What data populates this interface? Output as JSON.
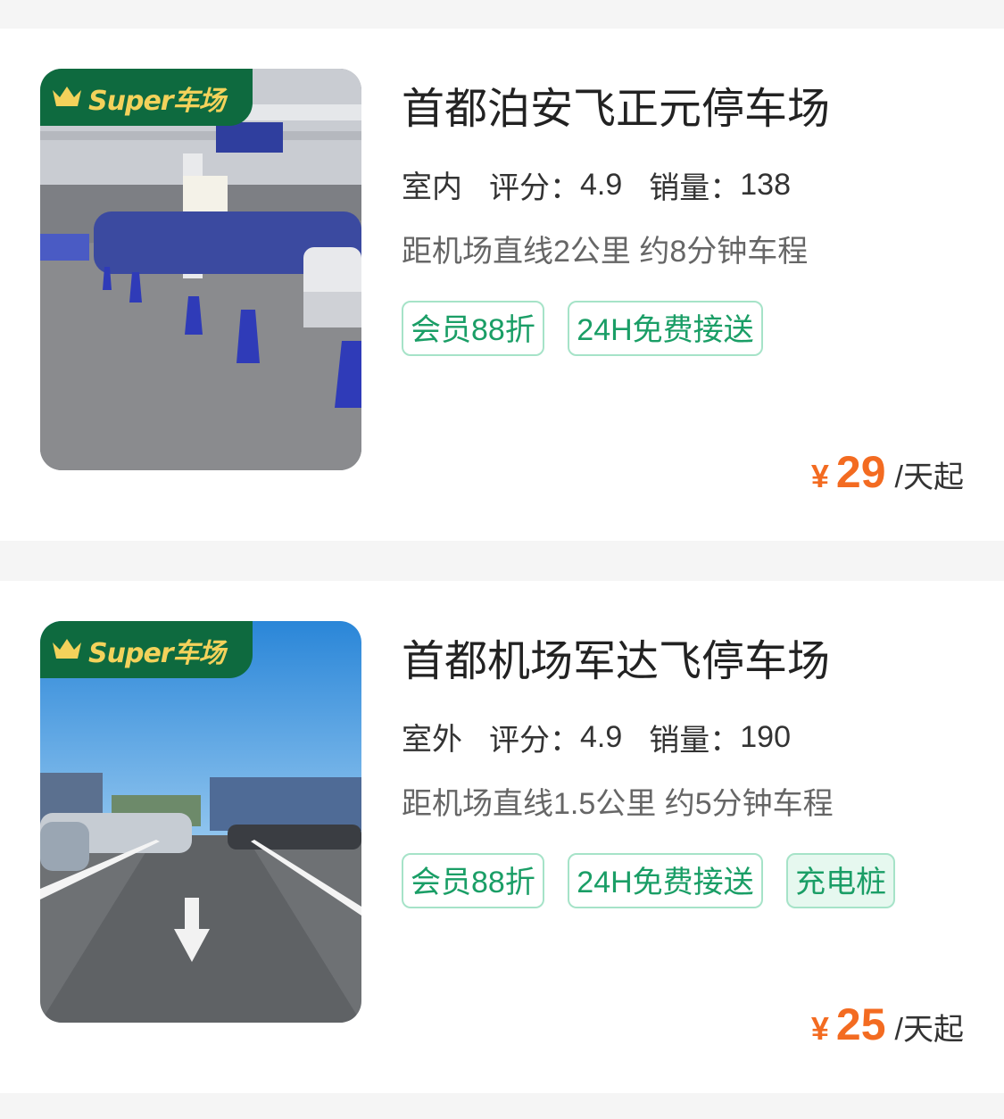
{
  "listings": [
    {
      "badge": "Super车场",
      "name": "首都泊安飞正元停车场",
      "environment": "室内",
      "rating_label": "评分：",
      "rating": "4.9",
      "sales_label": "销量：",
      "sales": "138",
      "distance": "距机场直线2公里 约8分钟车程",
      "tags": [
        "会员88折",
        "24H免费接送"
      ],
      "price_currency": "¥",
      "price": "29",
      "price_unit": "/天起"
    },
    {
      "badge": "Super车场",
      "name": "首都机场军达飞停车场",
      "environment": "室外",
      "rating_label": "评分：",
      "rating": "4.9",
      "sales_label": "销量：",
      "sales": "190",
      "distance": "距机场直线1.5公里 约5分钟车程",
      "tags": [
        "会员88折",
        "24H免费接送",
        "充电桩"
      ],
      "price_currency": "¥",
      "price": "25",
      "price_unit": "/天起"
    }
  ],
  "colors": {
    "accent_green": "#1a9e66",
    "badge_green": "#0e6a3f",
    "price_orange": "#f36b21"
  }
}
